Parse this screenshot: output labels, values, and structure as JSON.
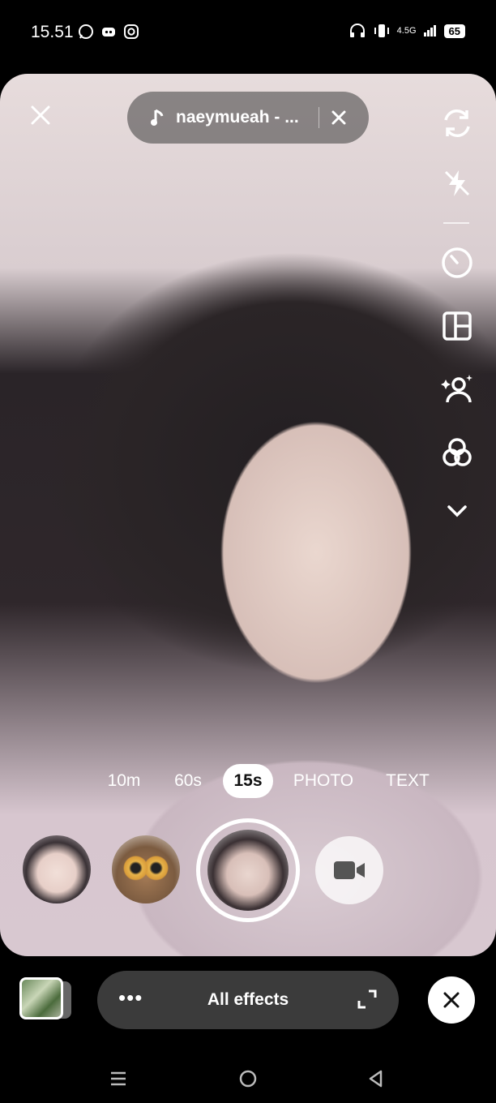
{
  "status_bar": {
    "time": "15.51",
    "network": "4.5G",
    "battery": "65",
    "icons": [
      "whatsapp-icon",
      "discord-icon",
      "instagram-icon",
      "headphones-icon",
      "vibrate-icon",
      "signal-icon"
    ]
  },
  "top": {
    "close_icon": "close-icon",
    "music": {
      "icon": "music-note-icon",
      "label": "naeymueah - ...",
      "remove_icon": "close-icon"
    }
  },
  "side_tools": [
    "flip-camera-icon",
    "flash-off-icon",
    "timer-icon",
    "layout-icon",
    "beauty-icon",
    "filters-icon",
    "chevron-down-icon"
  ],
  "modes": [
    {
      "label": "10m",
      "active": false
    },
    {
      "label": "60s",
      "active": false
    },
    {
      "label": "15s",
      "active": true
    },
    {
      "label": "PHOTO",
      "active": false
    },
    {
      "label": "TEXT",
      "active": false
    }
  ],
  "effects_bar": {
    "more_icon": "more-icon",
    "label": "All effects",
    "expand_icon": "expand-icon",
    "close_icon": "close-icon"
  },
  "nav": {
    "icons": [
      "menu-icon",
      "home-icon",
      "back-icon"
    ]
  }
}
